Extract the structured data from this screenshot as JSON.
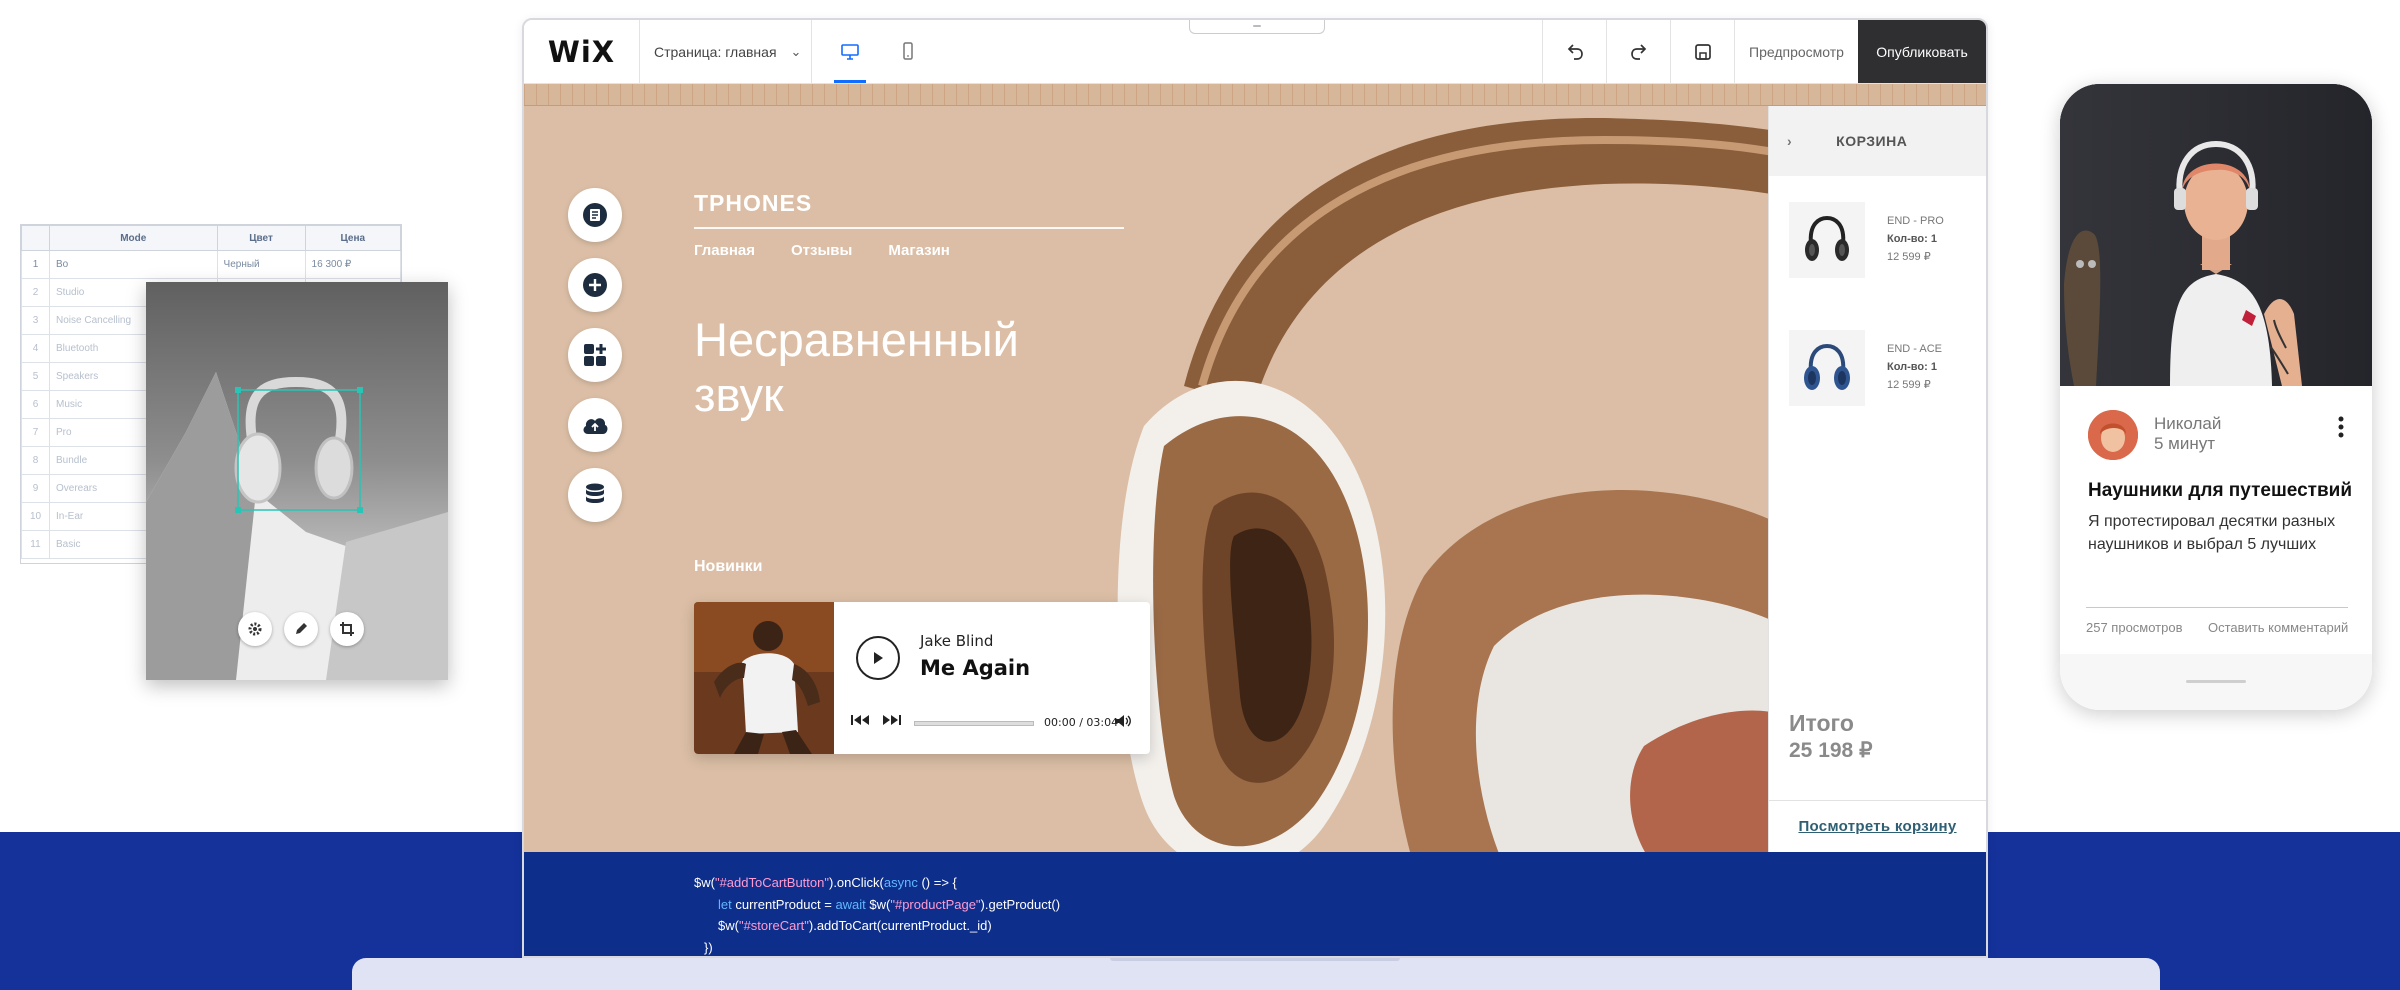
{
  "editor": {
    "logo": "WiX",
    "page_selector": "Страница: главная",
    "preview_label": "Предпросмотр",
    "publish_label": "Опубликовать"
  },
  "site": {
    "brand": "TPHONES",
    "nav": [
      "Главная",
      "Отзывы",
      "Магазин"
    ],
    "hero": "Несравненный звук",
    "news_label": "Новинки"
  },
  "player": {
    "artist": "Jake Blind",
    "song": "Me Again",
    "time": "00:00 / 03:04"
  },
  "cart": {
    "title": "КОРЗИНА",
    "items": [
      {
        "name": "END - PRO",
        "qty": "Кол-во: 1",
        "price": "12 599 ₽"
      },
      {
        "name": "END - ACE",
        "qty": "Кол-во: 1",
        "price": "12 599 ₽"
      }
    ],
    "total_label": "Итого",
    "total_value": "25 198 ₽",
    "view_cart": "Посмотреть корзину"
  },
  "code": {
    "l1a": "$w(",
    "l1b": "\"#addToCartButton\"",
    "l1c": ").onClick(",
    "l1d": "async",
    "l1e": " () => {",
    "l2a": "let",
    "l2b": " currentProduct = ",
    "l2c": "await",
    "l2d": " $w(",
    "l2e": "\"#productPage\"",
    "l2f": ").getProduct()",
    "l3a": "$w(",
    "l3b": "\"#storeCart\"",
    "l3c": ").addToCart(currentProduct._id)",
    "l4": "})"
  },
  "sheet": {
    "headers": [
      "",
      "Mode",
      "Цвет",
      "Цена"
    ],
    "rows": [
      [
        "1",
        "Bo",
        "Черный",
        "16 300 ₽"
      ],
      [
        "2",
        "Studio",
        "",
        ""
      ],
      [
        "3",
        "Noise Cancelling",
        "",
        ""
      ],
      [
        "4",
        "Bluetooth",
        "",
        ""
      ],
      [
        "5",
        "Speakers",
        "",
        ""
      ],
      [
        "6",
        "Music",
        "",
        ""
      ],
      [
        "7",
        "Pro",
        "",
        ""
      ],
      [
        "8",
        "Bundle",
        "",
        ""
      ],
      [
        "9",
        "Overears",
        "",
        ""
      ],
      [
        "10",
        "In-Ear",
        "",
        ""
      ],
      [
        "11",
        "Basic",
        "",
        ""
      ]
    ]
  },
  "blog": {
    "author": "Николай",
    "time": "5 минут",
    "title": "Наушники для путешествий",
    "text": "Я протестировал десятки разных наушников и выбрал 5 лучших",
    "views": "257 просмотров",
    "comment": "Оставить комментарий"
  },
  "colors": {
    "accent": "#116dff",
    "canvas": "#dbbea5",
    "band": "#14329a",
    "publish": "#2f2f31"
  }
}
